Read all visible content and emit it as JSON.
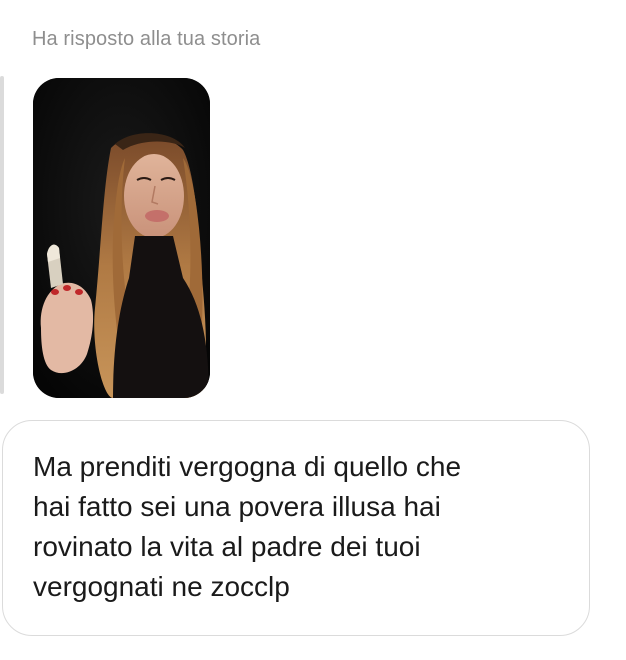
{
  "reply": {
    "header_text": "Ha risposto alla tua storia"
  },
  "story": {
    "thumbnail_icon": "story-video-thumbnail"
  },
  "message": {
    "text": "Ma prenditi vergogna di quello che\nhai fatto sei una povera illusa hai\nrovinato la vita al padre dei tuoi\nvergognati ne zocclp"
  }
}
